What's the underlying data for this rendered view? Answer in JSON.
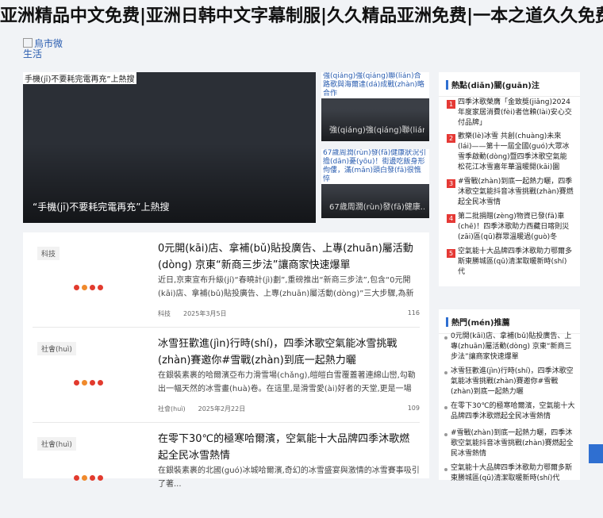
{
  "site": {
    "title": "亚洲精品中文免费|亚洲日韩中文字幕制服|久久精品亚洲免费|一本之道久久免费",
    "logo_alt": "烏市微生活"
  },
  "hero": {
    "main": {
      "alt": "手機(jī)不要耗完電再充”上熱搜",
      "caption": "“手機(jī)不要耗完電再充”上熱搜"
    },
    "side": [
      {
        "alt": "強(qiáng)強(qiáng)聯(lián)合 路歌與海爾達(dá)成戰(zhàn)略合作",
        "caption": "強(qiáng)強(qiáng)聯(lián..."
      },
      {
        "alt": "67歲周潤(rùn)發(fā)健康狀況引擔(dān)憂(yōu)！街邊吃飯身形佝僂，滿(mǎn)頭白發(fā)很憔悴",
        "caption": "67歲周潤(rùn)發(fā)健康..."
      }
    ]
  },
  "news": [
    {
      "tag": "科技",
      "title": "0元開(kāi)店、拿補(bǔ)貼投廣告、上專(zhuān)屬活動(dòng) 京東“新商三步法”讓商家快速爆單",
      "summary": "近日,京東宣布升級(jí)“春曉計(jì)劃”,重磅推出“新商三步法”,包含“0元開(kāi)店、拿補(bǔ)貼投廣告、上專(zhuān)屬活動(dòng)”三大步驟,為新商家提供了聽(tīng)...",
      "category": "科技",
      "date": "2025年3月5日",
      "views": "116"
    },
    {
      "tag": "社會(huì)",
      "title": "冰雪狂歡進(jìn)行時(shí)，四季沐歌空氣能冰雪挑戰(zhàn)賽邀你#雪戰(zhàn)到底一起熱力曬",
      "summary": "在銀裝素裹的哈爾濱亞布力滑雪場(chǎng),皚皚白雪覆蓋著連綿山巒,勾勒出一幅天然的冰雪畫(huà)卷。在這里,是滑雪愛(ài)好者的天堂,更是一場(chǎng)...",
      "category": "社會(huì)",
      "date": "2025年2月22日",
      "views": "109"
    },
    {
      "tag": "社會(huì)",
      "title": "在零下30℃的極寒哈爾濱，空氣能十大品牌四季沐歌燃起全民冰雪熱情",
      "summary": "在銀裝素裹的北國(guó)冰城哈爾濱,奇幻的冰雪盛宴與激情的冰雪賽事吸引了著...",
      "category": "社會(huì)",
      "date": "",
      "views": ""
    }
  ],
  "hot": {
    "title": "熱點(diǎn)關(guān)注",
    "items": [
      {
        "num": "1",
        "text": "四季沐歌榮膺「金致獎(jiǎng)2024年度家居消費(fèi)者信賴(lài)安心交付品牌」"
      },
      {
        "num": "2",
        "text": "歡樂(lè)冰雪 共創(chuàng)未來(lái)——第十一屆全國(guó)大眾冰雪季啟動(dòng)暨四季沐歌空氣能松花江冰雪嘉年華溫暖開(kāi)園"
      },
      {
        "num": "3",
        "text": "#雪戰(zhàn)到底一起熱力曬，四季沐歌空氣能抖音冰雪挑戰(zhàn)賽燃起全民冰雪情"
      },
      {
        "num": "4",
        "text": "第二批捐贈(zèng)物資已發(fā)車(chē)！四季沐歌助力西藏日喀則災(zāi)區(qū)群眾溫暖過(guò)冬"
      },
      {
        "num": "5",
        "text": "空氣能十大品牌四季沐歌助力鄂爾多斯東勝城區(qū)清潔取暖新時(shí)代"
      }
    ]
  },
  "recommend": {
    "title": "熱門(mén)推薦",
    "items": [
      {
        "text": "0元開(kāi)店、拿補(bǔ)貼投廣告、上專(zhuān)屬活動(dòng) 京東“新商三步法”讓商家快速爆單"
      },
      {
        "text": "冰雪狂歡進(jìn)行時(shí)，四季沐歌空氣能冰雪挑戰(zhàn)賽邀你#雪戰(zhàn)到底一起熱力曬"
      },
      {
        "text": "在零下30℃的極寒哈爾濱，空氣能十大品牌四季沐歌燃起全民冰雪熱情"
      },
      {
        "text": "#雪戰(zhàn)到底一起熱力曬，四季沐歌空氣能抖音冰雪挑戰(zhàn)賽燃起全民冰雪熱情"
      },
      {
        "text": "空氣能十大品牌四季沐歌助力鄂爾多斯東勝城區(qū)清潔取暖新時(shí)代"
      }
    ]
  },
  "colors": {
    "accent": "#2f6fd1",
    "rank": "#e53935",
    "loader_red": "#e23b2e",
    "loader_orange": "#f08a2c"
  }
}
